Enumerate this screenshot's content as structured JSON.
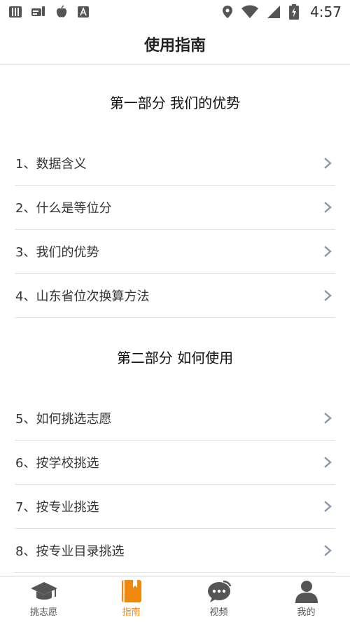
{
  "status_bar": {
    "time": "4:57"
  },
  "header": {
    "title": "使用指南"
  },
  "sections": [
    {
      "title": "第一部分 我们的优势",
      "items": [
        {
          "label": "1、数据含义"
        },
        {
          "label": "2、什么是等位分"
        },
        {
          "label": "3、我们的优势"
        },
        {
          "label": "4、山东省位次换算方法"
        }
      ]
    },
    {
      "title": "第二部分 如何使用",
      "items": [
        {
          "label": "5、如何挑选志愿"
        },
        {
          "label": "6、按学校挑选"
        },
        {
          "label": "7、按专业挑选"
        },
        {
          "label": "8、按专业目录挑选"
        }
      ]
    }
  ],
  "tabbar": {
    "tabs": [
      {
        "label": "挑志愿",
        "icon": "graduation-cap-icon"
      },
      {
        "label": "指南",
        "icon": "guide-book-icon"
      },
      {
        "label": "视频",
        "icon": "chat-bubble-icon"
      },
      {
        "label": "我的",
        "icon": "person-icon"
      }
    ],
    "active_color": "#f0890f",
    "inactive_color": "#555555"
  }
}
